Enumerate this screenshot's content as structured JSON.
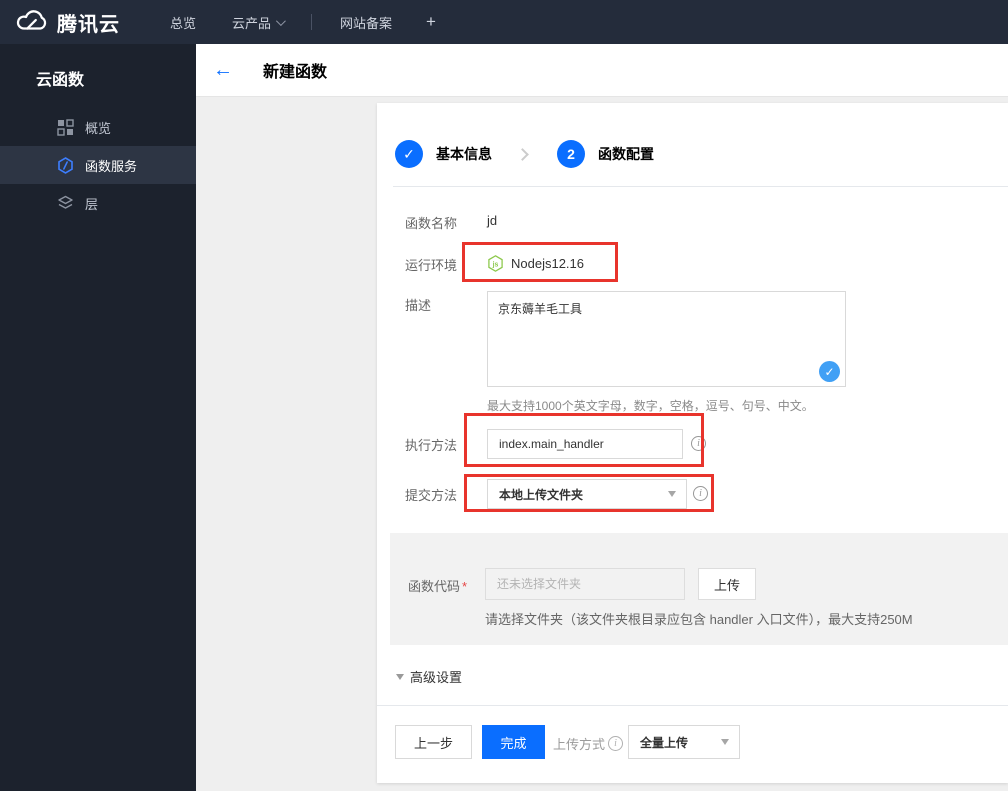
{
  "topnav": {
    "brand": "腾讯云",
    "menu": {
      "overview": "总览",
      "products": "云产品",
      "icp": "网站备案",
      "add": "+"
    }
  },
  "sidebar": {
    "title": "云函数",
    "items": [
      {
        "label": "概览",
        "active": false
      },
      {
        "label": "函数服务",
        "active": true
      },
      {
        "label": "层",
        "active": false
      }
    ]
  },
  "header": {
    "title": "新建函数"
  },
  "steps": {
    "step1": {
      "mark": "✓",
      "label": "基本信息"
    },
    "step2": {
      "num": "2",
      "label": "函数配置"
    }
  },
  "form": {
    "name": {
      "label": "函数名称",
      "value": "jd"
    },
    "runtime": {
      "label": "运行环境",
      "value": "Nodejs12.16",
      "icon": "nodejs-icon",
      "badge_text": "js"
    },
    "desc": {
      "label": "描述",
      "value": "京东薅羊毛工具",
      "check": "✓",
      "hint": "最大支持1000个英文字母，数字，空格，逗号、句号、中文。"
    },
    "handler": {
      "label": "执行方法",
      "value": "index.main_handler"
    },
    "submit": {
      "label": "提交方法",
      "value": "本地上传文件夹"
    },
    "code": {
      "label": "函数代码",
      "required": "*",
      "placeholder": "还未选择文件夹",
      "upload": "上传",
      "hint": "请选择文件夹（该文件夹根目录应包含 handler 入口文件），最大支持250M"
    },
    "advanced": {
      "label": "高级设置"
    }
  },
  "footer": {
    "prev": "上一步",
    "finish": "完成",
    "upload_mode_label": "上传方式",
    "upload_mode_value": "全量上传"
  },
  "colors": {
    "accent_blue": "#0a6eff",
    "annotation_red": "#e8342c",
    "nodejs_green": "#8cc84b",
    "validation_blue": "#41a0f5",
    "navbar_bg": "#242c3b",
    "sidebar_bg": "#1c222d",
    "sidebar_active_bg": "#2d3544"
  }
}
